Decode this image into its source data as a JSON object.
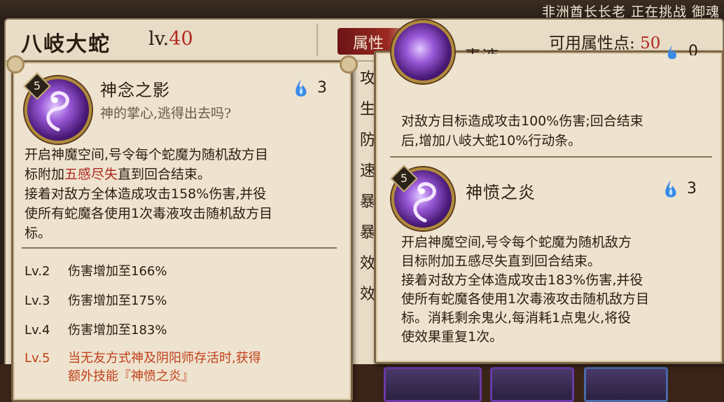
{
  "ticker": "非洲酋长长老 正在挑战 御魂",
  "character": {
    "name": "八岐大蛇",
    "level_label": "lv.",
    "level": "40"
  },
  "attributes": {
    "tab_label": "属性",
    "points_label": "可用属性点:",
    "points": "50",
    "stats": [
      "攻",
      "生",
      "防",
      "速",
      "暴",
      "暴",
      "效",
      "效"
    ]
  },
  "left_skill": {
    "level_badge": "5",
    "name": "神念之影",
    "quote": "神的掌心,逃得出去吗?",
    "cost": "3",
    "desc_1": "开启神魔空间,号令每个蛇魔为随机敌方目",
    "desc_2a": "标附加",
    "desc_2_highlight": "五感尽失",
    "desc_2b": "直到回合结束。",
    "desc_3": "接着对敌方全体造成攻击158%伤害,并役",
    "desc_4": "使所有蛇魔各使用1次毒液攻击随机敌方目",
    "desc_5": "标。",
    "upgrades": [
      {
        "level": "Lv.2",
        "text": "伤害增加至166%"
      },
      {
        "level": "Lv.3",
        "text": "伤害增加至175%"
      },
      {
        "level": "Lv.4",
        "text": "伤害增加至183%"
      },
      {
        "level": "Lv.5",
        "text": "当无友方式神及阴阳师存活时,获得",
        "text2": "额外技能『神愤之炎』"
      }
    ]
  },
  "right_top_skill": {
    "name_partial": "毒液",
    "cost_partial": "0",
    "desc_1": "对敌方目标造成攻击100%伤害;回合结束",
    "desc_2": "后,增加八岐大蛇10%行动条。"
  },
  "right_skill": {
    "level_badge": "5",
    "name": "神愤之炎",
    "cost": "3",
    "desc_1": "开启神魔空间,号令每个蛇魔为随机敌方",
    "desc_2": "目标附加五感尽失直到回合结束。",
    "desc_3": "接着对敌方全体造成攻击183%伤害,并役",
    "desc_4": "使所有蛇魔各使用1次毒液攻击随机敌方目",
    "desc_5": "标。消耗剩余鬼火,每消耗1点鬼火,将役",
    "desc_6": "使效果重复1次。"
  }
}
